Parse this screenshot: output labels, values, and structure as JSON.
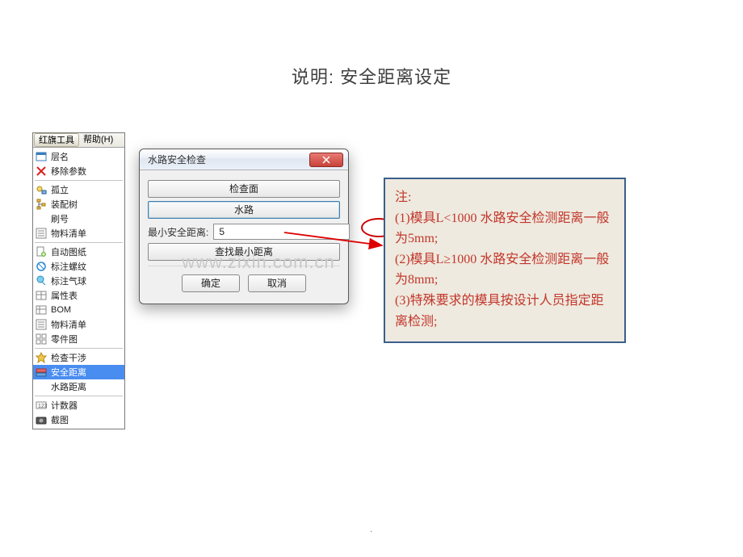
{
  "title": "说明: 安全距离设定",
  "menubar": {
    "tab1": "红旗工具",
    "tab2": "帮助(H)"
  },
  "menu": {
    "items": [
      {
        "icon": "layer",
        "label": "层名"
      },
      {
        "icon": "x-red",
        "label": "移除参数"
      }
    ],
    "items2": [
      {
        "icon": "orphan",
        "label": "孤立"
      },
      {
        "icon": "tree",
        "label": "装配树"
      },
      {
        "icon": "",
        "label": "刷号"
      },
      {
        "icon": "list",
        "label": "物料清单"
      }
    ],
    "items3": [
      {
        "icon": "doc-plus",
        "label": "自动图纸"
      },
      {
        "icon": "thread",
        "label": "标注螺纹"
      },
      {
        "icon": "balloon",
        "label": "标注气球"
      },
      {
        "icon": "table",
        "label": "属性表"
      },
      {
        "icon": "table",
        "label": "BOM"
      },
      {
        "icon": "list",
        "label": "物料清单"
      },
      {
        "icon": "grid",
        "label": "零件图"
      }
    ],
    "items4": [
      {
        "icon": "star",
        "label": "检查干涉"
      },
      {
        "icon": "safety",
        "label": "安全距离",
        "selected": true
      },
      {
        "icon": "",
        "label": "水路距离"
      }
    ],
    "items5": [
      {
        "icon": "counter",
        "label": "计数器"
      },
      {
        "icon": "camera",
        "label": "截图"
      }
    ]
  },
  "dialog": {
    "title": "水路安全检查",
    "btn_check_face": "检查面",
    "btn_waterway": "水路",
    "min_dist_label": "最小安全距离:",
    "min_dist_value": "5",
    "btn_find_min": "查找最小距离",
    "ok": "确定",
    "cancel": "取消"
  },
  "annotation": {
    "l0": "注:",
    "l1": "(1)模具L<1000 水路安全检测距离一般为5mm;",
    "l2": "(2)模具L≥1000 水路安全检测距离一般为8mm;",
    "l3": "(3)特殊要求的模具按设计人员指定距离检测;"
  },
  "watermark": "www.zixin.com.cn",
  "footer": "."
}
